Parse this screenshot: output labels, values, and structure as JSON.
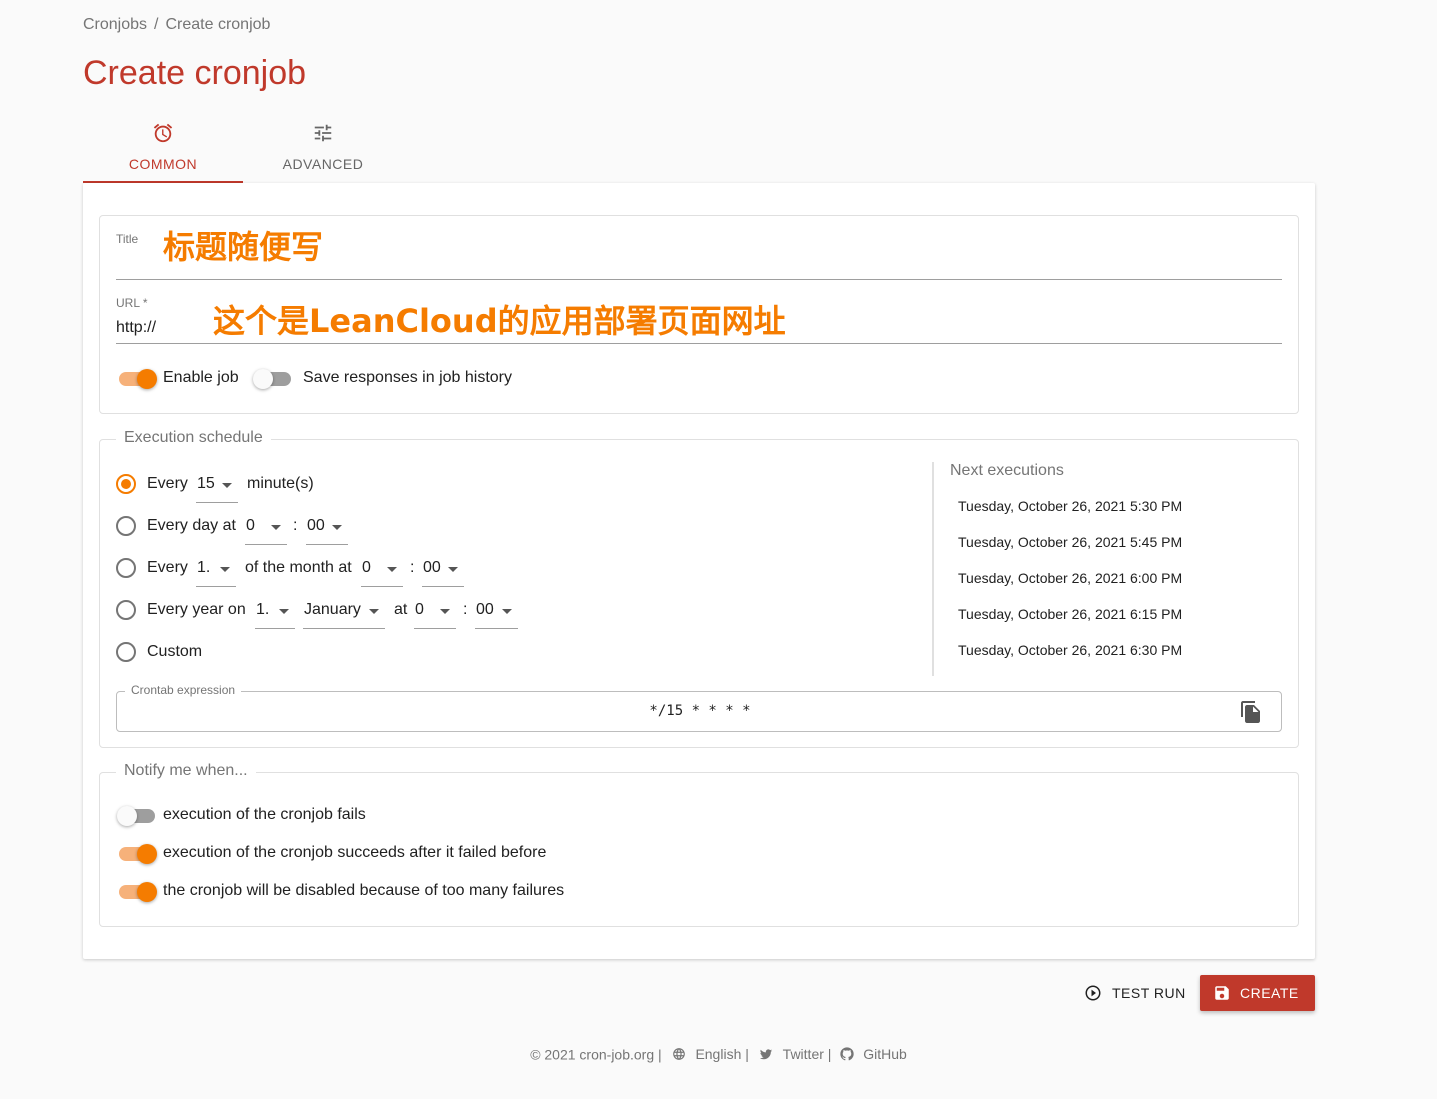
{
  "breadcrumb": {
    "parent": "Cronjobs",
    "separator": "/",
    "current": "Create cronjob"
  },
  "page_title": "Create cronjob",
  "tabs": [
    {
      "label": "COMMON",
      "icon": "alarm-icon",
      "active": true
    },
    {
      "label": "ADVANCED",
      "icon": "tune-icon",
      "active": false
    }
  ],
  "form": {
    "title_label": "Title",
    "title_overlay": "标题随便写",
    "url_label": "URL *",
    "url_value": "http://",
    "url_overlay": "这个是LeanCloud的应用部署页面网址",
    "enable_job": {
      "label": "Enable job",
      "on": true
    },
    "save_responses": {
      "label": "Save responses in job history",
      "on": false
    }
  },
  "schedule": {
    "legend": "Execution schedule",
    "every_minutes": {
      "prefix": "Every",
      "value": "15",
      "suffix": "minute(s)",
      "checked": true
    },
    "every_day": {
      "prefix": "Every day at",
      "hour": "0",
      "colon": ":",
      "minute": "00"
    },
    "every_month": {
      "prefix": "Every",
      "day": "1.",
      "middle": "of the month at",
      "hour": "0",
      "colon": ":",
      "minute": "00"
    },
    "every_year": {
      "prefix": "Every year on",
      "day": "1.",
      "month": "January",
      "at": "at",
      "hour": "0",
      "colon": ":",
      "minute": "00"
    },
    "custom": {
      "label": "Custom"
    },
    "next_title": "Next executions",
    "next": [
      "Tuesday, October 26, 2021 5:30 PM",
      "Tuesday, October 26, 2021 5:45 PM",
      "Tuesday, October 26, 2021 6:00 PM",
      "Tuesday, October 26, 2021 6:15 PM",
      "Tuesday, October 26, 2021 6:30 PM"
    ],
    "crontab_label": "Crontab expression",
    "crontab_value": "*/15 * * * *"
  },
  "notify": {
    "legend": "Notify me when...",
    "items": [
      {
        "label": "execution of the cronjob fails",
        "on": false
      },
      {
        "label": "execution of the cronjob succeeds after it failed before",
        "on": true
      },
      {
        "label": "the cronjob will be disabled because of too many failures",
        "on": true
      }
    ]
  },
  "actions": {
    "test_run": "TEST RUN",
    "create": "CREATE"
  },
  "footer": {
    "copyright": "© 2021 cron-job.org |",
    "language": "English |",
    "twitter": "Twitter |",
    "github": "GitHub"
  },
  "colors": {
    "accent": "#c0392b",
    "toggle": "#f57c00"
  }
}
